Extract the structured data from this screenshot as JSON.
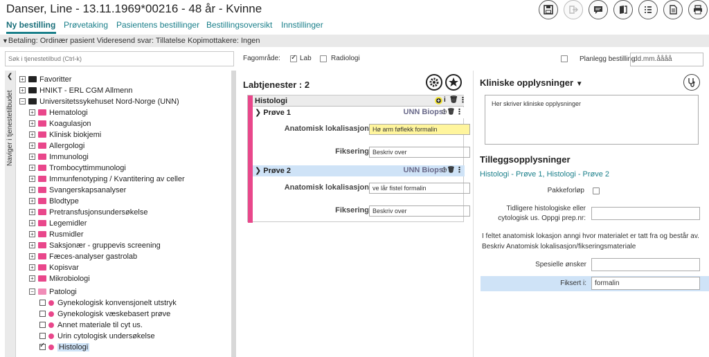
{
  "header": {
    "title": "Danser, Line - 13.11.1969*00216 - 48 år - Kvinne"
  },
  "nav_tabs": [
    {
      "label": "Ny bestilling",
      "active": true
    },
    {
      "label": "Prøvetaking"
    },
    {
      "label": "Pasientens bestillinger"
    },
    {
      "label": "Bestillingsoversikt"
    },
    {
      "label": "Innstillinger"
    }
  ],
  "payment_bar": "Betaling: Ordinær pasient Videresend svar: Tillatelse Kopimottakere: Ingen",
  "search": {
    "placeholder": "Søk i tjenestetilbud (Ctrl-k)"
  },
  "fagomrade": {
    "label": "Fagområde:",
    "lab": {
      "label": "Lab",
      "checked": true
    },
    "radiologi": {
      "label": "Radiologi",
      "checked": false
    }
  },
  "planlegg": {
    "label": "Planlegg bestilling",
    "checked": false,
    "date_placeholder": "dd.mm.åååå"
  },
  "side_strip_label": "Naviger i tjenestetilbudet",
  "tree": {
    "top_nodes": [
      "Favoritter",
      "HNIKT - ERL CGM Allmenn",
      "Universitetssykehuset Nord-Norge (UNN)"
    ],
    "unn_children": [
      "Hematologi",
      "Koagulasjon",
      "Klinisk biokjemi",
      "Allergologi",
      "Immunologi",
      "Trombocyttimmunologi",
      "Immunfenotyping / Kvantitering av celler",
      "Svangerskapsanalyser",
      "Blodtype",
      "Pretransfusjonsundersøkelse",
      "Legemidler",
      "Rusmidler",
      "Saksjonær - gruppevis screening",
      "Fæces-analyser gastrolab",
      "Kopisvar",
      "Mikrobiologi",
      "Patologi"
    ],
    "patologi_children": [
      {
        "label": "Gynekologisk konvensjonelt utstryk",
        "checked": false
      },
      {
        "label": "Gynekologisk væskebasert prøve",
        "checked": false
      },
      {
        "label": "Annet materiale til cyt us.",
        "checked": false
      },
      {
        "label": "Urin cytologisk undersøkelse",
        "checked": false
      },
      {
        "label": "Histologi",
        "checked": true
      }
    ]
  },
  "labtjenester": {
    "title": "Labtjenester : 2",
    "group": "Histologi",
    "samples": [
      {
        "name": "Prøve 1",
        "unit": "UNN Biopsi",
        "anatomisk_label": "Anatomisk lokalisasjon",
        "anatomisk_value": "Hø arm føflekk formalin",
        "fiksering_label": "Fiksering",
        "fiksering_value": "Beskriv over"
      },
      {
        "name": "Prøve 2",
        "unit": "UNN Biopsi",
        "anatomisk_label": "Anatomisk lokalisasjon",
        "anatomisk_value": "ve lår fistel formalin",
        "fiksering_label": "Fiksering",
        "fiksering_value": "Beskriv over"
      }
    ]
  },
  "kliniske": {
    "title": "Kliniske opplysninger",
    "text": "Her skriver kliniske opplysninger"
  },
  "tillegg": {
    "title": "Tilleggsopplysninger",
    "link": "Histologi - Prøve 1, Histologi - Prøve 2",
    "pakkeforlop": "Pakkeforløp",
    "tidligere": "Tidligere histologiske eller cytologisk us. Oppgi prep.nr:",
    "info": "I feltet anatomisk lokasjon anngi hvor materialet er tatt fra og består av. Beskriv Anatomisk lokalisasjon/fikseringsmateriale",
    "spesielle": "Spesielle ønsker",
    "fiksert_label": "Fiksert i:",
    "fiksert_value": "formalin"
  }
}
